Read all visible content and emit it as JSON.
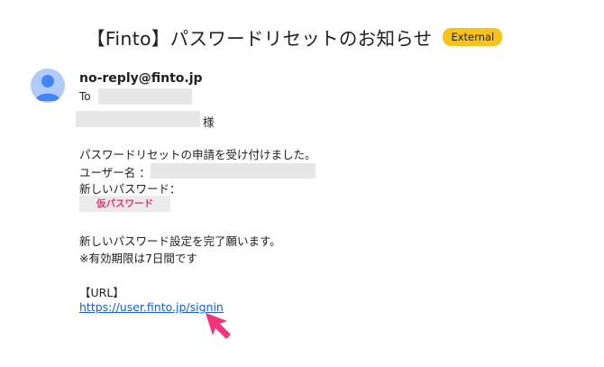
{
  "email": {
    "subject": "【Finto】パスワードリセットのお知らせ",
    "badge": "External",
    "sender": "no-reply@finto.jp",
    "to_label": "To",
    "salutation_suffix": "様",
    "line_request": "パスワードリセットの申請を受け付けました。",
    "username_label": "ユーザー名 ：",
    "new_password_label": "新しいパスワード：",
    "temp_password": "仮パスワード",
    "line_complete": "新しいパスワード設定を完了願います。",
    "line_expiry": "※有効期限は7日間です",
    "url_header": "【URL】",
    "url_link": "https://user.finto.jp/signin"
  },
  "colors": {
    "badge": "#f7c21a",
    "avatar_bg": "#aecbfa",
    "avatar_fg": "#4285f4",
    "temp_password_text": "#e8336f",
    "link": "#1a5fd0",
    "cursor": "#f0357a"
  }
}
